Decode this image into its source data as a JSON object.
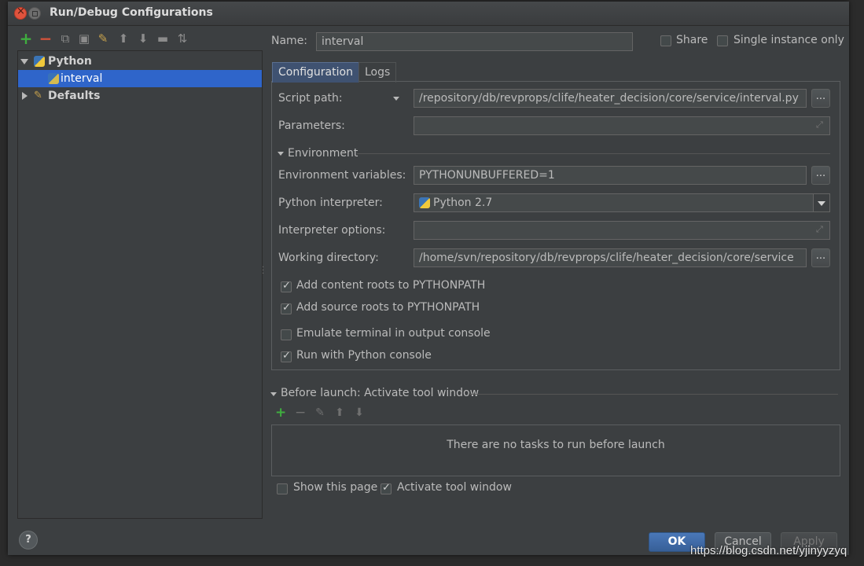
{
  "dialog": {
    "title": "Run/Debug Configurations"
  },
  "toolbar": {
    "icons": [
      "add-icon",
      "remove-icon",
      "copy-icon",
      "save-icon",
      "wrench-icon",
      "move-up-icon",
      "move-down-icon",
      "folder-icon",
      "sort-icon"
    ]
  },
  "tree": {
    "python_label": "Python",
    "interval_label": "interval",
    "defaults_label": "Defaults"
  },
  "header": {
    "name_label": "Name:",
    "name_value": "interval",
    "share_label": "Share",
    "single_instance_label": "Single instance only"
  },
  "tabs": {
    "configuration": "Configuration",
    "logs": "Logs"
  },
  "config": {
    "script_path_label": "Script path:",
    "script_path_value": "/repository/db/revprops/clife/heater_decision/core/service/interval.py",
    "parameters_label": "Parameters:",
    "environment_label": "Environment",
    "env_vars_label": "Environment variables:",
    "env_vars_value": "PYTHONUNBUFFERED=1",
    "interpreter_label": "Python interpreter:",
    "interpreter_value": "Python 2.7",
    "interpreter_options_label": "Interpreter options:",
    "working_dir_label": "Working directory:",
    "working_dir_value": "/home/svn/repository/db/revprops/clife/heater_decision/core/service",
    "dots": "...",
    "add_content_roots": "Add content roots to PYTHONPATH",
    "add_source_roots": "Add source roots to PYTHONPATH",
    "emulate_terminal": "Emulate terminal in output console",
    "run_with_console": "Run with Python console"
  },
  "checkbox_states": {
    "share": false,
    "single_instance": false,
    "add_content_roots": true,
    "add_source_roots": true,
    "emulate_terminal": false,
    "run_with_console": true,
    "show_this_page": false,
    "activate_tool_window": true
  },
  "before_launch": {
    "title": "Before launch: Activate tool window",
    "empty_text": "There are no tasks to run before launch",
    "show_this_page_label": "Show this page",
    "activate_tool_window_label": "Activate tool window"
  },
  "buttons": {
    "ok": "OK",
    "cancel": "Cancel",
    "apply": "Apply",
    "help": "?"
  },
  "watermark": "https://blog.csdn.net/yjinyyzyq",
  "colors": {
    "dialog_bg": "#3c3f41",
    "selection": "#2f65ca",
    "active_tab": "#3f5271",
    "ok_button": "#4a78b8"
  }
}
